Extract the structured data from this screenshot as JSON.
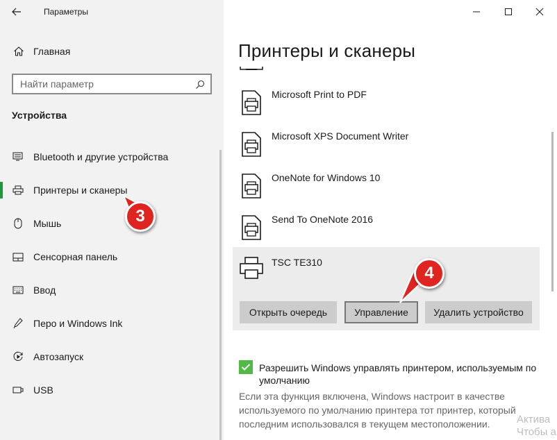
{
  "window": {
    "title": "Параметры",
    "controls": {
      "minimize": "minimize-icon",
      "maximize": "maximize-icon",
      "close": "close-icon"
    }
  },
  "sidebar": {
    "home_label": "Главная",
    "search_placeholder": "Найти параметр",
    "section_title": "Устройства",
    "items": [
      {
        "label": "Bluetooth и другие устройства",
        "icon": "bluetooth-devices-icon"
      },
      {
        "label": "Принтеры и сканеры",
        "icon": "printer-icon",
        "selected": true
      },
      {
        "label": "Мышь",
        "icon": "mouse-icon"
      },
      {
        "label": "Сенсорная панель",
        "icon": "touchpad-icon"
      },
      {
        "label": "Ввод",
        "icon": "keyboard-icon"
      },
      {
        "label": "Перо и Windows Ink",
        "icon": "pen-icon"
      },
      {
        "label": "Автозапуск",
        "icon": "autoplay-icon"
      },
      {
        "label": "USB",
        "icon": "usb-icon"
      }
    ]
  },
  "main": {
    "title": "Принтеры и сканеры",
    "devices": [
      {
        "name": "Microsoft Print to PDF"
      },
      {
        "name": "Microsoft XPS Document Writer"
      },
      {
        "name": "OneNote for Windows 10"
      },
      {
        "name": "Send To OneNote 2016"
      }
    ],
    "selected_device": {
      "name": "TSC TE310",
      "buttons": {
        "open_queue": "Открыть очередь",
        "manage": "Управление",
        "remove": "Удалить устройство"
      }
    },
    "default_printer_checkbox": {
      "checked": true,
      "label": "Разрешить Windows управлять принтером, используемым по умолчанию"
    },
    "description": "Если эта функция включена, Windows настроит в качестве используемого по умолчанию принтера тот принтер, который последним использовался в текущем местоположении.",
    "watermark_line1": "Актива",
    "watermark_line2": "Чтобы а"
  },
  "annotations": {
    "step3": "3",
    "step4": "4",
    "color": "#e0241f"
  },
  "colors": {
    "accent": "#1a9a3b",
    "checkbox": "#52b848",
    "sidebar_bg": "#f2f2f2",
    "button_bg": "#cccccc"
  }
}
